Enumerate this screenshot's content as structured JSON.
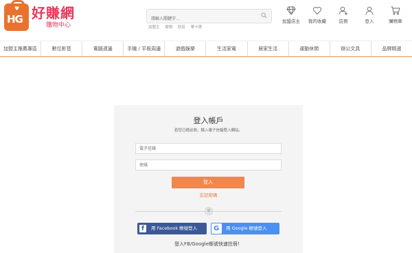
{
  "brand": {
    "logo_text": "HG",
    "name": "好賺網",
    "subtitle": "購物中心",
    "color": "#e8385b",
    "bag_color": "#e8732f"
  },
  "search": {
    "placeholder": "請輸入關鍵字...",
    "hot_tags": [
      "加盟主",
      "電物",
      "防疫",
      "華卡惠"
    ]
  },
  "top_nav": [
    {
      "icon": "diamond-icon",
      "label": "加盟店主"
    },
    {
      "icon": "heart-icon",
      "label": "我的收藏"
    },
    {
      "icon": "user-plus-icon",
      "label": "註冊"
    },
    {
      "icon": "user-icon",
      "label": "登入"
    },
    {
      "icon": "cart-icon",
      "label": "購物車"
    }
  ],
  "categories": [
    "加盟主推薦專區",
    "數位影音",
    "電腦週邊",
    "手機 / 平板周邊",
    "遊戲娛樂",
    "生活家電",
    "居家生活",
    "運動休閒",
    "辦公文具",
    "品牌精選"
  ],
  "login": {
    "title": "登入帳戶",
    "subtitle": "若您已經註冊，輸入電子信箱登入網站。",
    "email_placeholder": "電子信箱",
    "password_placeholder": "密碼",
    "submit_label": "登入",
    "forgot_label": "忘記密碼",
    "divider_text": "或",
    "facebook_label": "用 Facebook 帳號登入",
    "google_label": "用 Google 帳號登入",
    "quick_register": "登入FB/Google帳號快速註冊！"
  },
  "colors": {
    "accent": "#f0874f",
    "facebook": "#3b5998",
    "google": "#4b8ff0",
    "panel_bg": "#f4f4f4"
  }
}
